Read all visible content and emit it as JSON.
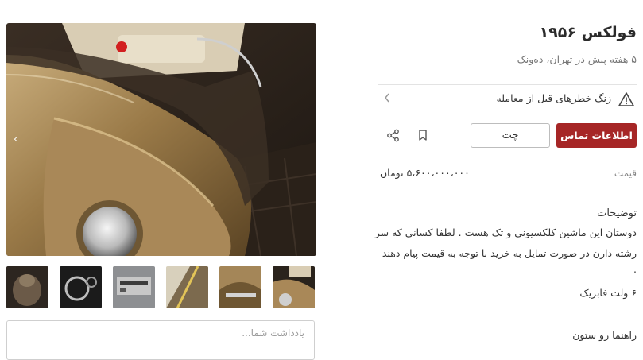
{
  "listing": {
    "title": "فولکس ۱۹۵۶",
    "subtitle": "۵ هفته پیش در تهران، دەونک"
  },
  "risk_banner": {
    "label": "زنگ خطرهای قبل از معامله",
    "icon": "warning-triangle-icon",
    "chevron_icon": "chevron-left-icon"
  },
  "actions": {
    "contact_label": "اطلاعات تماس",
    "chat_label": "چت",
    "bookmark_icon": "bookmark-icon",
    "share_icon": "share-icon",
    "primary_color": "#a62626"
  },
  "price": {
    "label": "قیمت",
    "value": "۵،۶۰۰،۰۰۰،۰۰۰ تومان"
  },
  "description": {
    "title": "توضیحات",
    "lines": [
      "دوستان این ماشین کلکسیونی و تک هست . لطفا کسانی که سر",
      "رشته دارن در صورت تمایل به خرید با توجه به قیمت پیام دهند",
      ".",
      "۶ ولت فابریک"
    ]
  },
  "guide": {
    "heading": "راهنما رو ستون"
  },
  "gallery": {
    "next_arrow": "‹",
    "thumbnail_count": 6
  },
  "note": {
    "placeholder": "یادداشت شما..."
  }
}
